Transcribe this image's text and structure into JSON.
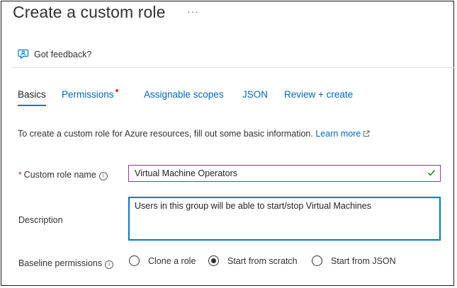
{
  "page": {
    "title": "Create a custom role",
    "more_label": "···"
  },
  "feedback": {
    "label": "Got feedback?"
  },
  "tabs": [
    {
      "label": "Basics",
      "active": true
    },
    {
      "label": "Permissions",
      "required_indicator": true
    },
    {
      "label": "Assignable scopes"
    },
    {
      "label": "JSON"
    },
    {
      "label": "Review + create"
    }
  ],
  "intro": {
    "text": "To create a custom role for Azure resources, fill out some basic information.",
    "link_label": "Learn more"
  },
  "form": {
    "role_name": {
      "required_mark": "*",
      "label": "Custom role name",
      "value": "Virtual Machine Operators",
      "valid": true
    },
    "description": {
      "label": "Description",
      "value": "Users in this group will be able to start/stop Virtual Machines"
    },
    "baseline": {
      "label": "Baseline permissions",
      "options": [
        {
          "label": "Clone a role",
          "selected": false
        },
        {
          "label": "Start from scratch",
          "selected": true
        },
        {
          "label": "Start from JSON",
          "selected": false
        }
      ]
    }
  },
  "colors": {
    "accent": "#0078d4",
    "link": "#0067b8",
    "required": "#d13438",
    "valid_check": "#107c10"
  }
}
